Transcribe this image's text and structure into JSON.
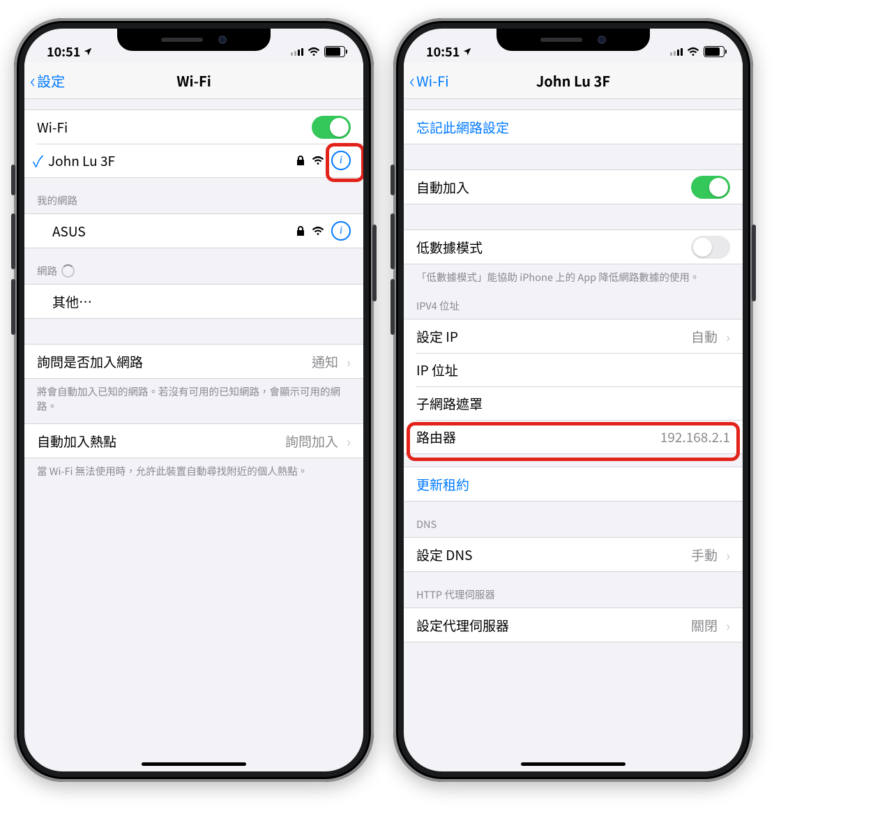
{
  "left": {
    "status_time": "10:51",
    "back_label": "設定",
    "title": "Wi-Fi",
    "wifi_toggle_label": "Wi-Fi",
    "connected_network": "John Lu 3F",
    "my_networks_header": "我的網路",
    "networks_header": "網路",
    "known_network": "ASUS",
    "other_label": "其他⋯",
    "ask_join": {
      "label": "詢問是否加入網路",
      "value": "通知"
    },
    "ask_join_footer": "將會自動加入已知的網路。若沒有可用的已知網路，會顯示可用的網路。",
    "hotspot": {
      "label": "自動加入熱點",
      "value": "詢問加入"
    },
    "hotspot_footer": "當 Wi-Fi 無法使用時，允許此裝置自動尋找附近的個人熱點。"
  },
  "right": {
    "status_time": "10:51",
    "back_label": "Wi-Fi",
    "title": "John Lu 3F",
    "forget_label": "忘記此網路設定",
    "auto_join_label": "自動加入",
    "low_data_label": "低數據模式",
    "low_data_footer": "「低數據模式」能協助 iPhone 上的 App 降低網路數據的使用。",
    "ipv4_header": "IPV4 位址",
    "configure_ip": {
      "label": "設定 IP",
      "value": "自動"
    },
    "ip_address_label": "IP 位址",
    "subnet_label": "子網路遮罩",
    "router": {
      "label": "路由器",
      "value": "192.168.2.1"
    },
    "renew_label": "更新租約",
    "dns_header": "DNS",
    "configure_dns": {
      "label": "設定 DNS",
      "value": "手動"
    },
    "proxy_header": "HTTP 代理伺服器",
    "configure_proxy": {
      "label": "設定代理伺服器",
      "value": "關閉"
    }
  }
}
